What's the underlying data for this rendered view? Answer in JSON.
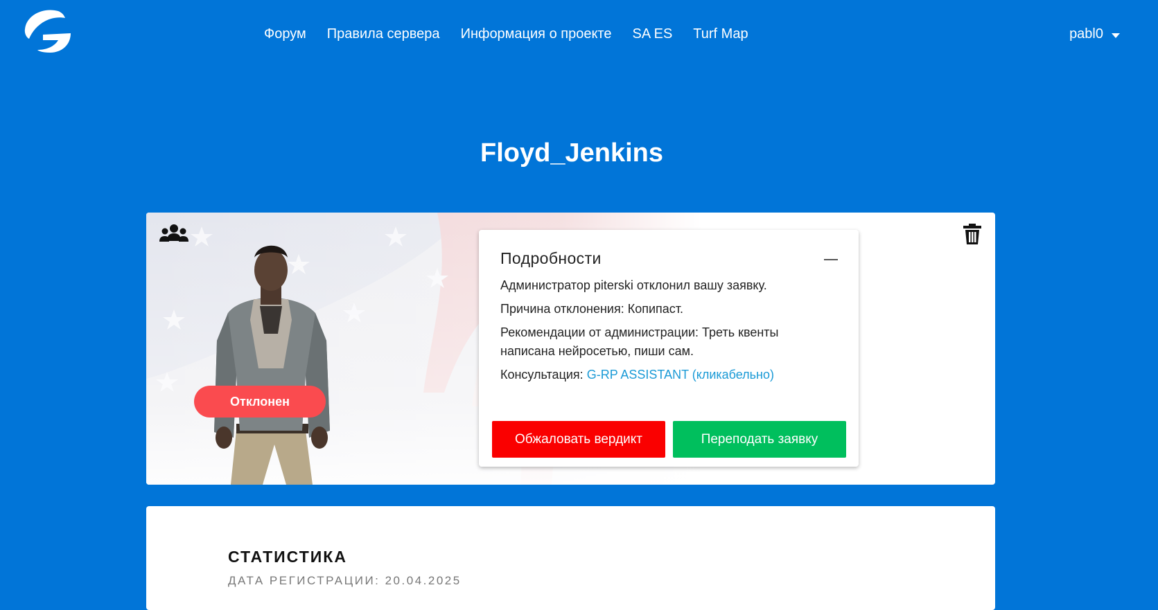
{
  "navbar": {
    "logo_icon": "g-logo-icon",
    "links": [
      {
        "label": "Форум"
      },
      {
        "label": "Правила сервера"
      },
      {
        "label": "Информация о проекте"
      },
      {
        "label": "SA ES"
      },
      {
        "label": "Turf Map"
      }
    ],
    "username": "pabl0"
  },
  "profile": {
    "name": "Floyd_Jenkins",
    "status": "Отклонен",
    "status_color": "#fa4b4f",
    "group_icon": "users-icon",
    "delete_icon": "trash-icon"
  },
  "details": {
    "title": "Подробности",
    "admin_line": "Администратор piterski отклонил вашу заявку.",
    "reason_line": "Причина отклонения: Копипаст.",
    "recommend_line": "Рекомендации от администрации: Треть квенты написана нейросетью, пиши сам.",
    "consult_label": "Консультация:",
    "consult_link": "G-RP ASSISTANT (кликабельно)",
    "appeal_button": "Обжаловать вердикт",
    "resubmit_button": "Переподать заявку"
  },
  "stats": {
    "title": "СТАТИСТИКА",
    "registration": "ДАТА РЕГИСТРАЦИИ: 20.04.2025"
  },
  "colors": {
    "background": "#0175d8",
    "appeal": "#fa0000",
    "resubmit": "#00bf5d",
    "link": "#1a9ad6"
  }
}
